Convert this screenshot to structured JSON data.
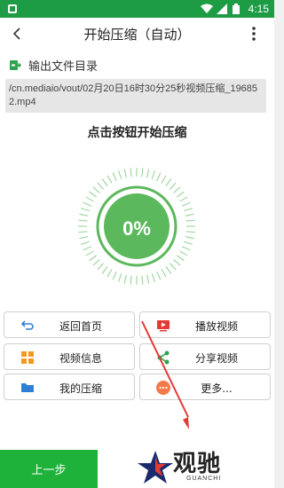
{
  "statusbar": {
    "time": "4:15"
  },
  "appbar": {
    "title": "开始压缩（自动）"
  },
  "output": {
    "label": "输出文件目录",
    "path": "/cn.mediaio/vout/02月20日16时30分25秒视频压缩_196852.mp4"
  },
  "prompt": "点击按钮开始压缩",
  "progress": {
    "text": "0%",
    "value": 0
  },
  "actions": {
    "home": "返回首页",
    "play": "播放视频",
    "info": "视频信息",
    "share": "分享视频",
    "mine": "我的压缩",
    "more": "更多..."
  },
  "footer": {
    "prev": "上一步"
  },
  "watermark": {
    "brand": "观驰",
    "sub": "GUANCHI"
  },
  "colors": {
    "primary": "#1fb23a",
    "statusbar": "#1e9c45",
    "dial": "#5cb85c",
    "arrow": "#e53935"
  }
}
